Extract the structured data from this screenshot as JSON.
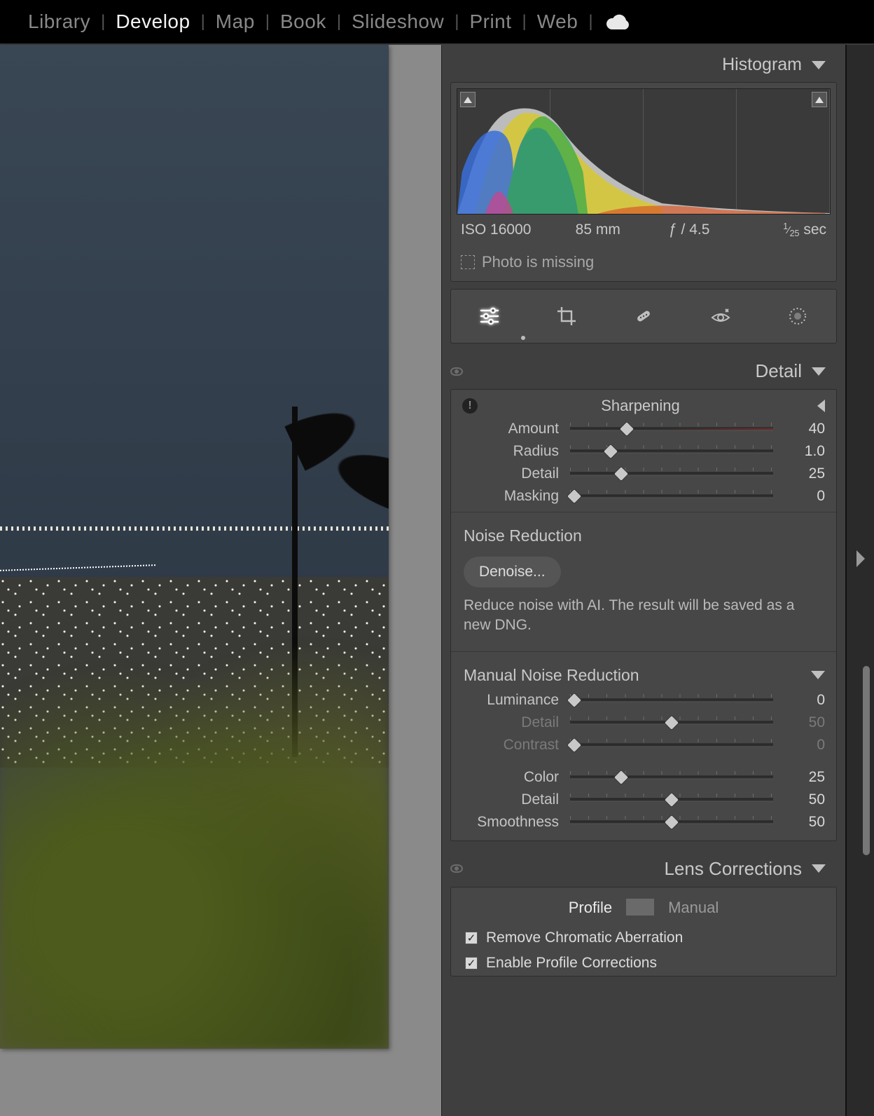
{
  "nav": {
    "tabs": [
      "Library",
      "Develop",
      "Map",
      "Book",
      "Slideshow",
      "Print",
      "Web"
    ],
    "active_index": 1
  },
  "panels": {
    "histogram": {
      "title": "Histogram",
      "iso": "ISO 16000",
      "focal": "85 mm",
      "aperture": "ƒ / 4.5",
      "shutter": "1⁄25 sec",
      "shutter_num": "1",
      "shutter_den": "25",
      "shutter_suffix": "sec",
      "missing": "Photo is missing"
    },
    "detail": {
      "title": "Detail",
      "sharpening": {
        "title": "Sharpening",
        "amount": {
          "label": "Amount",
          "value": "40",
          "pos": 28
        },
        "radius": {
          "label": "Radius",
          "value": "1.0",
          "pos": 20
        },
        "detail": {
          "label": "Detail",
          "value": "25",
          "pos": 25
        },
        "masking": {
          "label": "Masking",
          "value": "0",
          "pos": 2
        }
      },
      "noise": {
        "title": "Noise Reduction",
        "button": "Denoise...",
        "help": "Reduce noise with AI. The result will be saved as a new DNG."
      },
      "manual": {
        "title": "Manual Noise Reduction",
        "luminance": {
          "label": "Luminance",
          "value": "0",
          "pos": 2
        },
        "ldetail": {
          "label": "Detail",
          "value": "50",
          "pos": 50,
          "dim": true
        },
        "lcontrast": {
          "label": "Contrast",
          "value": "0",
          "pos": 2,
          "dim": true
        },
        "color": {
          "label": "Color",
          "value": "25",
          "pos": 25
        },
        "cdetail": {
          "label": "Detail",
          "value": "50",
          "pos": 50
        },
        "smooth": {
          "label": "Smoothness",
          "value": "50",
          "pos": 50
        }
      }
    },
    "lens": {
      "title": "Lens Corrections",
      "tab_profile": "Profile",
      "tab_manual": "Manual",
      "active_tab": "profile",
      "check1": "Remove Chromatic Aberration",
      "check2": "Enable Profile Corrections"
    }
  },
  "tools": [
    "edit",
    "crop",
    "heal",
    "redeye",
    "mask"
  ]
}
